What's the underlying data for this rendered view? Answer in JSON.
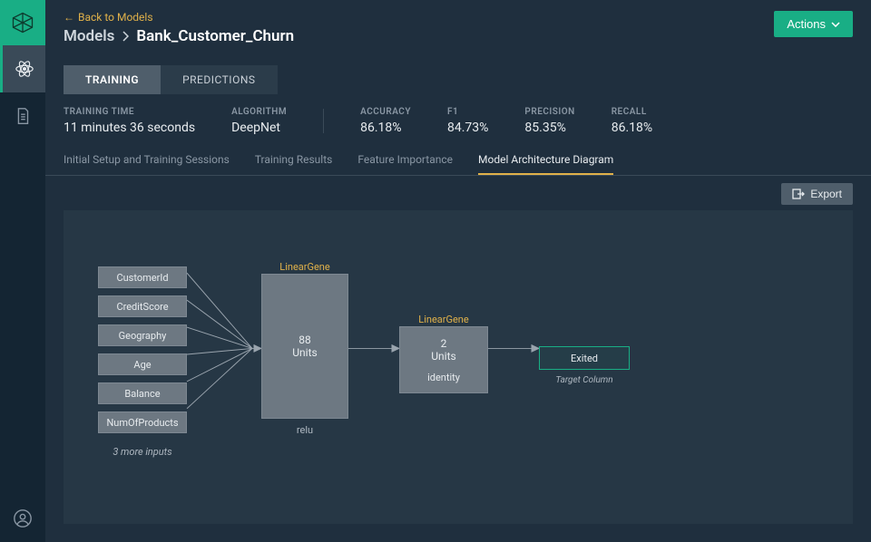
{
  "header": {
    "back_label": "Back to Models",
    "crumb1": "Models",
    "crumb2": "Bank_Customer_Churn",
    "actions_label": "Actions"
  },
  "top_tabs": {
    "training": "TRAINING",
    "predictions": "PREDICTIONS"
  },
  "stats": {
    "training_time_label": "TRAINING TIME",
    "training_time_value": "11 minutes 36 seconds",
    "algorithm_label": "ALGORITHM",
    "algorithm_value": "DeepNet",
    "accuracy_label": "ACCURACY",
    "accuracy_value": "86.18%",
    "f1_label": "F1",
    "f1_value": "84.73%",
    "precision_label": "PRECISION",
    "precision_value": "85.35%",
    "recall_label": "RECALL",
    "recall_value": "86.18%"
  },
  "subtabs": {
    "t0": "Initial Setup and Training Sessions",
    "t1": "Training Results",
    "t2": "Feature Importance",
    "t3": "Model Architecture Diagram"
  },
  "export_label": "Export",
  "diagram": {
    "inputs": {
      "i0": "CustomerId",
      "i1": "CreditScore",
      "i2": "Geography",
      "i3": "Age",
      "i4": "Balance",
      "i5": "NumOfProducts",
      "more": "3 more inputs"
    },
    "layer1": {
      "title": "LinearGene",
      "units_num": "88",
      "units_word": "Units",
      "activation": "relu"
    },
    "layer2": {
      "title": "LinearGene",
      "units_num": "2",
      "units_word": "Units",
      "activation": "identity"
    },
    "output": {
      "label": "Exited",
      "sub": "Target Column"
    }
  }
}
